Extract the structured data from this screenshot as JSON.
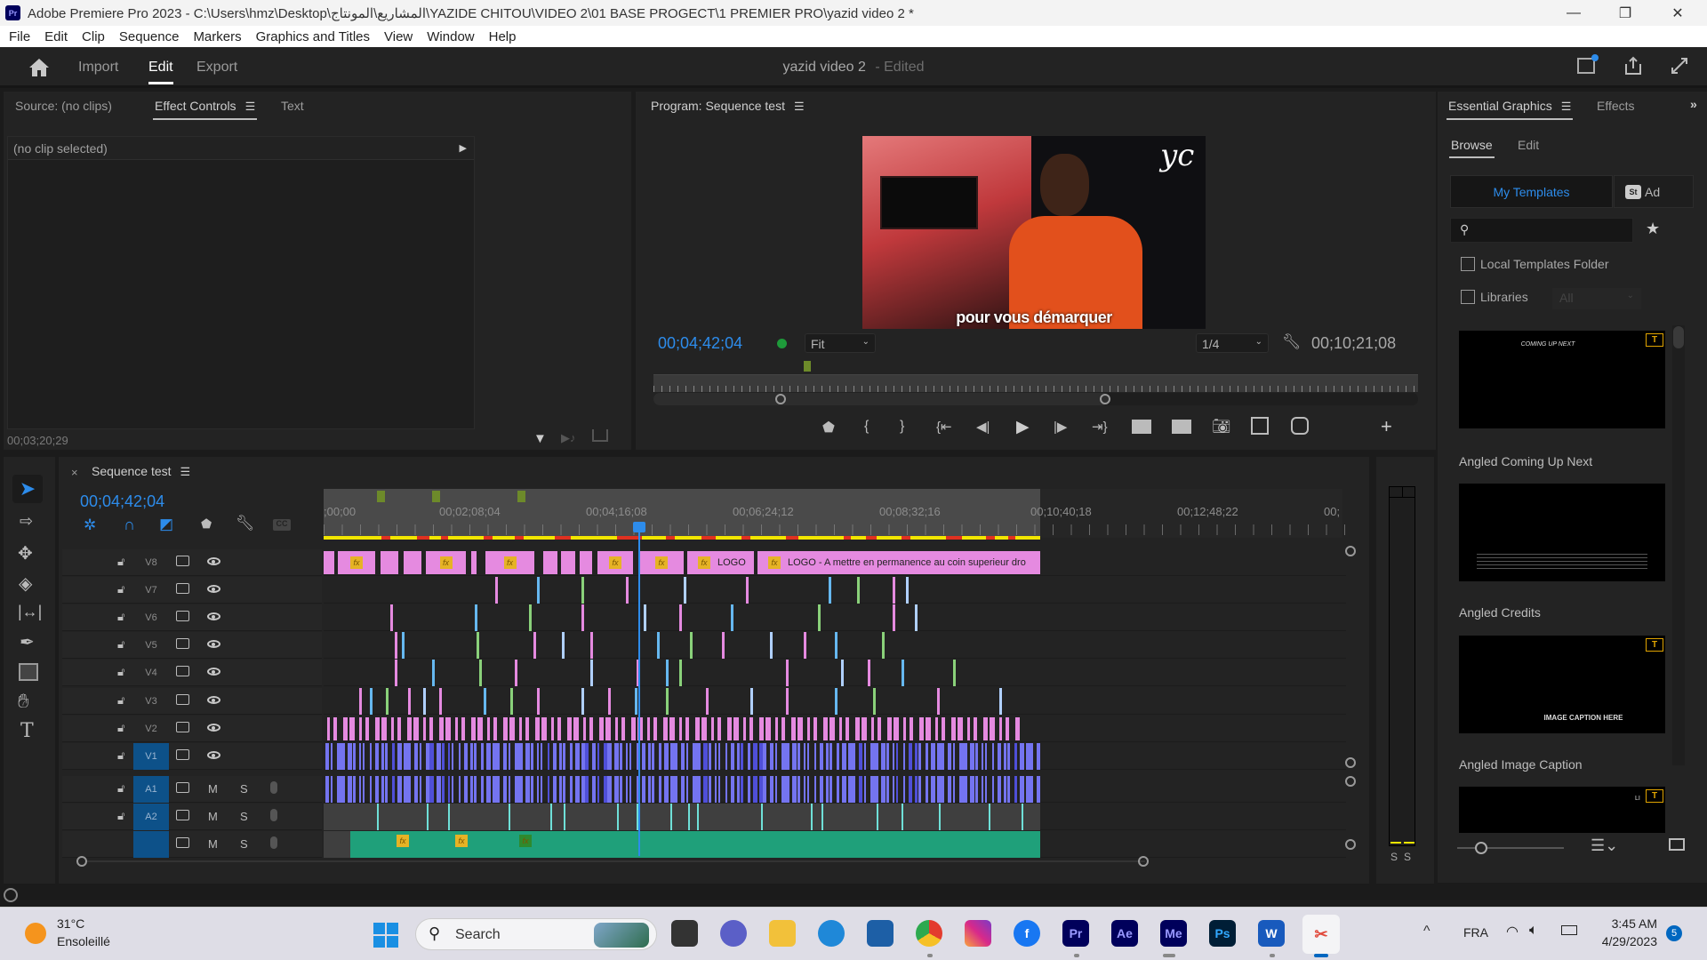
{
  "window": {
    "app_icon": "Pr",
    "title": "Adobe Premiere Pro 2023 - C:\\Users\\hmz\\Desktop\\المشاريع\\المونتاج\\YAZIDE CHITOU\\VIDEO 2\\01 BASE PROGECT\\1 PREMIER PRO\\yazid video 2 *",
    "controls": [
      "minimize",
      "restore",
      "close"
    ]
  },
  "menu": [
    "File",
    "Edit",
    "Clip",
    "Sequence",
    "Markers",
    "Graphics and Titles",
    "View",
    "Window",
    "Help"
  ],
  "header": {
    "tabs": [
      "Import",
      "Edit",
      "Export"
    ],
    "active_tab": "Edit",
    "project_name": "yazid video 2",
    "project_status": "- Edited"
  },
  "source_panel": {
    "tabs": [
      "Source: (no clips)",
      "Effect Controls",
      "Text"
    ],
    "active_tab": "Effect Controls",
    "no_clip_text": "(no clip selected)",
    "timecode": "00;03;20;29"
  },
  "program_monitor": {
    "title": "Program: Sequence test",
    "current_timecode": "00;04;42;04",
    "zoom": "Fit",
    "resolution": "1/4",
    "duration": "00;10;21;08",
    "subtitle_overlay": "pour vous démarquer",
    "logo_overlay": "yc",
    "playhead_position": 0.454
  },
  "essential_graphics": {
    "tabs": [
      "Essential Graphics",
      "Effects"
    ],
    "active_tab": "Essential Graphics",
    "subtabs": [
      "Browse",
      "Edit"
    ],
    "active_subtab": "Browse",
    "sources": [
      "My Templates",
      "Ad"
    ],
    "active_source": "My Templates",
    "search_placeholder": "",
    "local_templates_label": "Local Templates Folder",
    "local_templates_checked": false,
    "libraries_label": "Libraries",
    "libraries_checked": false,
    "libraries_select": "All",
    "templates": [
      {
        "name": "Angled Coming Up Next",
        "preview_text": "COMING UP NEXT",
        "warning": true
      },
      {
        "name": "Angled Credits",
        "preview_text": "",
        "warning": false
      },
      {
        "name": "Angled Image Caption",
        "preview_text": "IMAGE CAPTION HERE",
        "warning": true
      },
      {
        "name": "",
        "preview_text": "LI",
        "warning": true
      }
    ]
  },
  "timeline": {
    "sequence_name": "Sequence test",
    "timecode": "00;04;42;04",
    "ruler_labels": [
      ";00;00",
      "00;02;08;04",
      "00;04;16;08",
      "00;06;24;12",
      "00;08;32;16",
      "00;10;40;18",
      "00;12;48;22",
      "00;"
    ],
    "playhead_fraction": 0.454,
    "video_tracks": [
      {
        "name": "V8",
        "targeted": false
      },
      {
        "name": "V7",
        "targeted": false
      },
      {
        "name": "V6",
        "targeted": false
      },
      {
        "name": "V5",
        "targeted": false
      },
      {
        "name": "V4",
        "targeted": false
      },
      {
        "name": "V3",
        "targeted": false
      },
      {
        "name": "V2",
        "targeted": false
      },
      {
        "name": "V1",
        "targeted": true
      }
    ],
    "audio_tracks": [
      {
        "name": "A1",
        "targeted": true,
        "locked_icon": true
      },
      {
        "name": "A2",
        "targeted": true,
        "locked_icon": true
      },
      {
        "name": "",
        "targeted": true,
        "locked_icon": false
      }
    ],
    "audio_buttons": {
      "mute": "M",
      "solo": "S"
    },
    "v8_clip_labels": [
      "LOGO",
      "LOGO - A mettre en permanence au coin superieur dro"
    ],
    "colors": {
      "graphics_clip": "#e58ae0",
      "video_clip": "#7474f0",
      "audio_clip": "#1fa07a",
      "playhead": "#2d8ceb",
      "render_bar": "#f2e600"
    }
  },
  "audio_meter": {
    "solo_labels": [
      "S",
      "S"
    ]
  },
  "taskbar": {
    "weather_temp": "31°C",
    "weather_desc": "Ensoleillé",
    "search_label": "Search",
    "apps": [
      "Task View",
      "Meet",
      "File Explorer",
      "Edge",
      "Store",
      "Chrome",
      "Instagram",
      "Facebook",
      "Pr",
      "Ae",
      "Me",
      "Ps",
      "Word",
      "Snipping Tool"
    ],
    "language": "FRA",
    "time": "3:45 AM",
    "date": "4/29/2023",
    "notifications": "5"
  }
}
